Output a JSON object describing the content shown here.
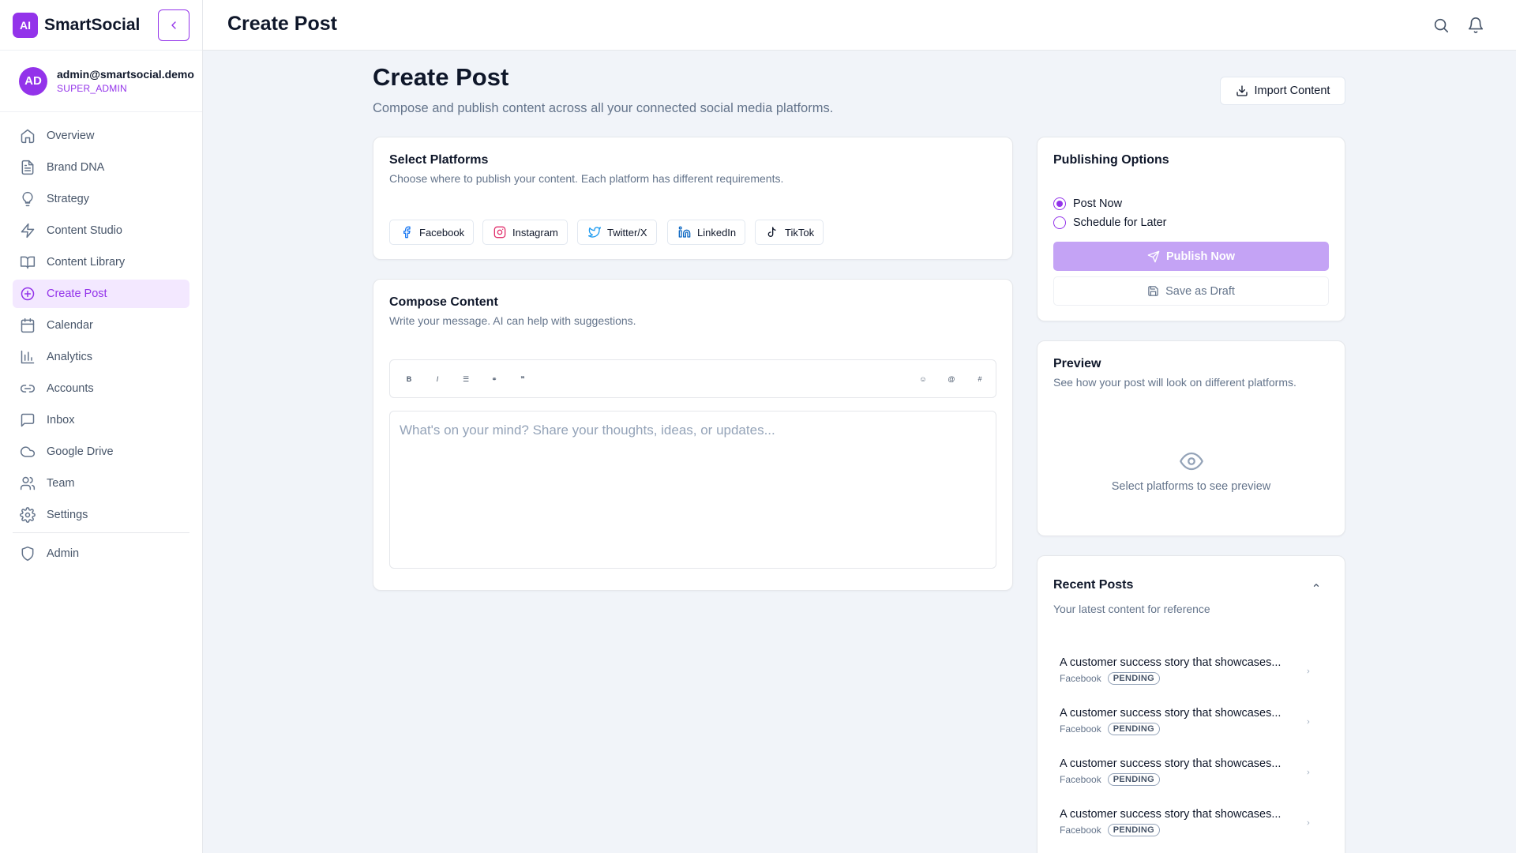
{
  "brand": {
    "logo": "AI",
    "name": "SmartSocial"
  },
  "user": {
    "initials": "AD",
    "email": "admin@smartsocial.demo",
    "role": "SUPER_ADMIN"
  },
  "nav": {
    "items": [
      {
        "label": "Overview",
        "icon": "home-icon"
      },
      {
        "label": "Brand DNA",
        "icon": "file-text-icon"
      },
      {
        "label": "Strategy",
        "icon": "lightbulb-icon"
      },
      {
        "label": "Content Studio",
        "icon": "zap-icon"
      },
      {
        "label": "Content Library",
        "icon": "book-open-icon"
      },
      {
        "label": "Create Post",
        "icon": "plus-circle-icon",
        "active": true
      },
      {
        "label": "Calendar",
        "icon": "calendar-icon"
      },
      {
        "label": "Analytics",
        "icon": "bar-chart-icon"
      },
      {
        "label": "Accounts",
        "icon": "link-icon"
      },
      {
        "label": "Inbox",
        "icon": "message-square-icon"
      },
      {
        "label": "Google Drive",
        "icon": "cloud-icon"
      },
      {
        "label": "Team",
        "icon": "users-icon"
      },
      {
        "label": "Settings",
        "icon": "settings-icon"
      }
    ],
    "admin": {
      "label": "Admin",
      "icon": "shield-icon"
    }
  },
  "topbar": {
    "title": "Create Post"
  },
  "header": {
    "title": "Create Post",
    "subtitle": "Compose and publish content across all your connected social media platforms.",
    "import_label": "Import Content"
  },
  "platforms_card": {
    "title": "Select Platforms",
    "subtitle": "Choose where to publish your content. Each platform has different requirements.",
    "platforms": [
      {
        "label": "Facebook",
        "icon": "facebook-icon",
        "color": "#1877f2"
      },
      {
        "label": "Instagram",
        "icon": "instagram-icon",
        "color": "#e1306c"
      },
      {
        "label": "Twitter/X",
        "icon": "twitter-icon",
        "color": "#1d9bf0"
      },
      {
        "label": "LinkedIn",
        "icon": "linkedin-icon",
        "color": "#0a66c2"
      },
      {
        "label": "TikTok",
        "icon": "tiktok-icon",
        "color": "#0f172a"
      }
    ]
  },
  "compose_card": {
    "title": "Compose Content",
    "subtitle": "Write your message. AI can help with suggestions.",
    "placeholder": "What's on your mind? Share your thoughts, ideas, or updates...",
    "toolbar": [
      "bold-icon",
      "italic-icon",
      "list-icon",
      "link-icon",
      "quote-icon",
      "emoji-icon",
      "mention-icon",
      "hashtag-icon"
    ]
  },
  "publishing": {
    "title": "Publishing Options",
    "options": [
      {
        "label": "Post Now",
        "selected": true
      },
      {
        "label": "Schedule for Later",
        "selected": false
      }
    ],
    "publish_label": "Publish Now",
    "draft_label": "Save as Draft"
  },
  "preview": {
    "title": "Preview",
    "subtitle": "See how your post will look on different platforms.",
    "empty_text": "Select platforms to see preview"
  },
  "recent": {
    "title": "Recent Posts",
    "subtitle": "Your latest content for reference",
    "items": [
      {
        "title": "A customer success story that showcases...",
        "platform": "Facebook",
        "status": "PENDING"
      },
      {
        "title": "A customer success story that showcases...",
        "platform": "Facebook",
        "status": "PENDING"
      },
      {
        "title": "A customer success story that showcases...",
        "platform": "Facebook",
        "status": "PENDING"
      },
      {
        "title": "A customer success story that showcases...",
        "platform": "Facebook",
        "status": "PENDING"
      }
    ]
  },
  "colors": {
    "accent": "#9333ea",
    "accent_light": "#f3e8ff",
    "publish_disabled": "#c4a3f5"
  }
}
